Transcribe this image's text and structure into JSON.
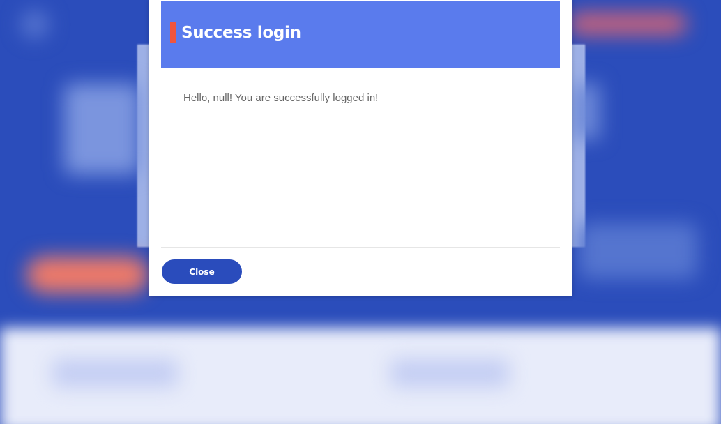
{
  "modal": {
    "title": "Success login",
    "message": "Hello, null! You are successfully logged in!",
    "close_label": "Close"
  },
  "colors": {
    "header": "#5a7bed",
    "accent": "#f0553d",
    "button": "#2a4cbc",
    "backdrop": "#2b4dbb"
  }
}
